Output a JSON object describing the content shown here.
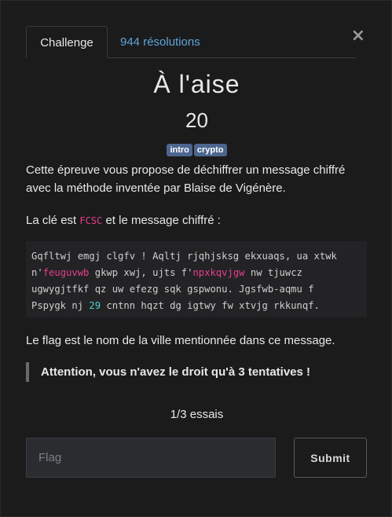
{
  "close_label": "×",
  "tabs": [
    {
      "label": "Challenge",
      "active": true
    },
    {
      "label": "944 résolutions",
      "active": false
    }
  ],
  "challenge": {
    "title": "À l'aise",
    "points": "20",
    "tags": [
      "intro",
      "crypto"
    ]
  },
  "description": {
    "intro": "Cette épreuve vous propose de déchiffrer un message chiffré avec la méthode inventée par Blaise de Vigénère.",
    "key_prefix": "La clé est ",
    "key": "FCSC",
    "key_suffix": " et le message chiffré :",
    "ciphertext_lines": [
      {
        "a": "Gqfltwj emgj clgfv ! Aqltj rjqhjsksg ekxuaqs, ua xtwk"
      },
      {
        "a": "n'",
        "hl1": "feuguvwb",
        "b": " gkwp xwj, ujts f'",
        "hl2": "npxkqvjgw",
        "c": " nw tjuwcz"
      },
      {
        "a": "ugwygjtfkf qz uw efezg sqk gspwonu. Jgsfwb-aqmu f"
      },
      {
        "a": "Pspygk nj ",
        "num": "29",
        "b": " cntnn hqzt dg igtwy fw xtvjg rkkunqf."
      }
    ],
    "flag_hint": "Le flag est le nom de la ville mentionnée dans ce message.",
    "warning": "Attention, vous n'avez le droit qu'à 3 tentatives !"
  },
  "attempts": "1/3 essais",
  "form": {
    "flag_placeholder": "Flag",
    "flag_value": "",
    "submit_label": "Submit"
  },
  "colors": {
    "background": "#1b1b1c",
    "link": "#5fa4d8",
    "tag": "#4d6690",
    "code_highlight": "#e83e8c",
    "code_number": "#4dd0c8"
  }
}
